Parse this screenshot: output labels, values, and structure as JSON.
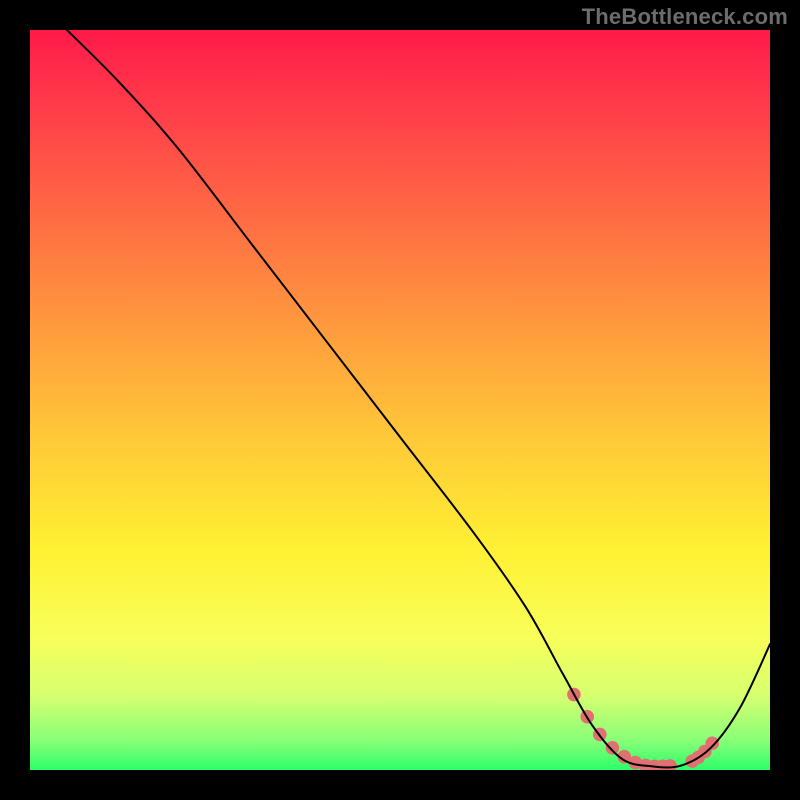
{
  "watermark": "TheBottleneck.com",
  "gradient": {
    "stops": [
      {
        "offset": 0.0,
        "color": "#ff1a4a"
      },
      {
        "offset": 0.1,
        "color": "#ff3a4a"
      },
      {
        "offset": 0.25,
        "color": "#ff6a44"
      },
      {
        "offset": 0.4,
        "color": "#ff9a3e"
      },
      {
        "offset": 0.55,
        "color": "#ffc838"
      },
      {
        "offset": 0.7,
        "color": "#fff033"
      },
      {
        "offset": 0.82,
        "color": "#f8ff5a"
      },
      {
        "offset": 0.9,
        "color": "#d6ff70"
      },
      {
        "offset": 0.96,
        "color": "#88ff78"
      },
      {
        "offset": 1.0,
        "color": "#2dff6a"
      }
    ]
  },
  "chart_data": {
    "type": "line",
    "title": "",
    "xlabel": "",
    "ylabel": "",
    "xlim": [
      0,
      100
    ],
    "ylim": [
      0,
      100
    ],
    "series": [
      {
        "name": "curve",
        "x": [
          5,
          12,
          20,
          30,
          40,
          50,
          60,
          67,
          72,
          76,
          80,
          84,
          88,
          92,
          96,
          100
        ],
        "y": [
          100,
          93,
          84,
          71,
          58,
          45,
          32,
          22,
          13,
          6,
          1.5,
          0.5,
          0.6,
          3,
          8.5,
          17
        ]
      },
      {
        "name": "highlight",
        "x": [
          73.5,
          75.3,
          77,
          78.7,
          80.3,
          81.8,
          83.2,
          84.4,
          85.5,
          86.5,
          89.5,
          90.3,
          91.2,
          92.2
        ],
        "y": [
          10.2,
          7.2,
          4.8,
          3.0,
          1.8,
          1.0,
          0.6,
          0.5,
          0.5,
          0.55,
          1.2,
          1.7,
          2.5,
          3.6
        ]
      }
    ],
    "styles": {
      "curve": {
        "stroke": "#000000",
        "strokeWidth": 2,
        "fill": "none"
      },
      "highlight": {
        "stroke": "none",
        "fill": "#e17070",
        "radius": 6.8
      }
    }
  }
}
